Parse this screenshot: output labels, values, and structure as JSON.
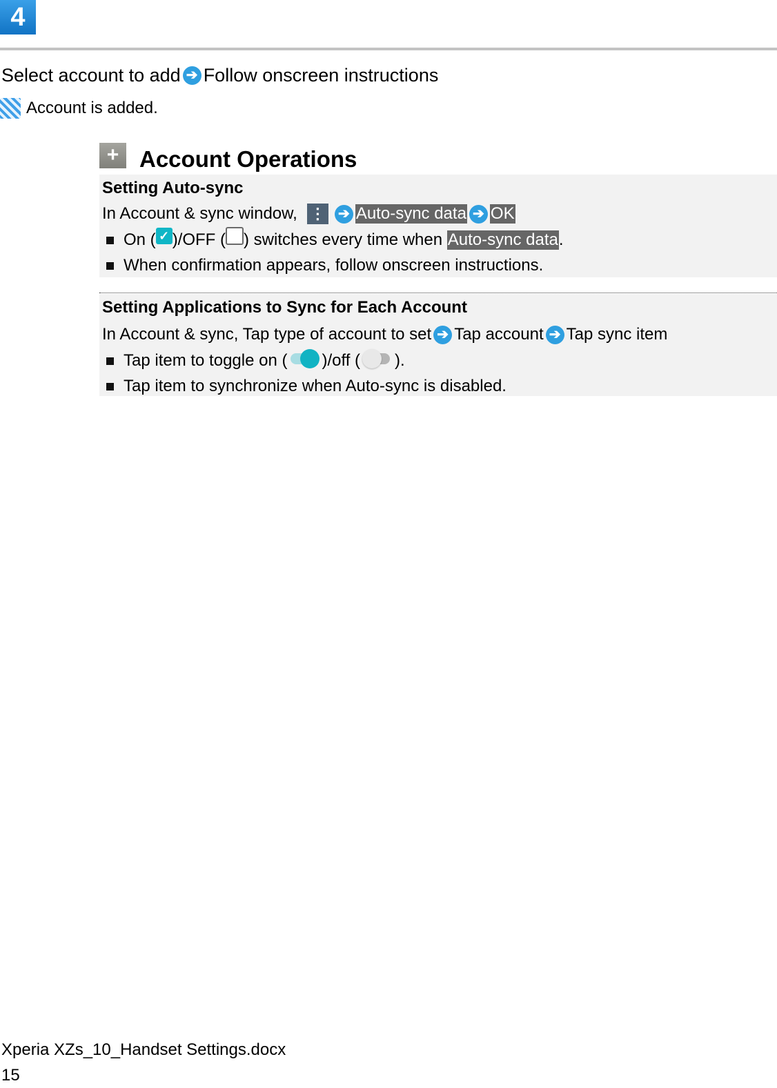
{
  "step": {
    "number": "4"
  },
  "instruction": {
    "part1": "Select account to add",
    "arrow_icon": "arrow-right-circle-icon",
    "part2": "Follow onscreen instructions"
  },
  "result": {
    "icon": "checkered-flag-icon",
    "text": "Account is added."
  },
  "section": {
    "icon": "plus-icon",
    "title": "Account Operations"
  },
  "auto_sync": {
    "heading": "Setting Auto-sync",
    "line1_prefix": "In Account & sync window,",
    "menu_icon": "⋮",
    "key1": "Auto-sync data",
    "key2": "OK",
    "bullets": [
      {
        "on_label": "On (",
        "mid_label": ")/OFF (",
        "tail_label": ") switches every time when ",
        "key": "Auto-sync data",
        "end": "."
      },
      {
        "text": "When confirmation appears, follow onscreen instructions."
      }
    ]
  },
  "app_sync": {
    "heading": "Setting Applications to Sync for Each Account",
    "steps": [
      "In Account & sync, Tap type of account to set",
      "Tap account",
      "Tap sync item"
    ],
    "bullets": [
      {
        "prefix": "Tap item to toggle on (",
        "mid": ")/off (",
        "end": ")."
      },
      {
        "text": "Tap item to synchronize when Auto-sync is disabled."
      }
    ]
  },
  "footer": {
    "filename": "Xperia XZs_10_Handset Settings.docx",
    "page_number": "15"
  }
}
